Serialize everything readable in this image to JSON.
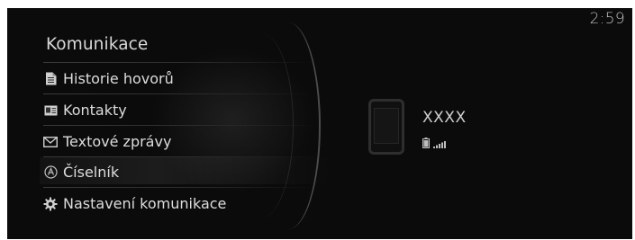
{
  "status_bar": {
    "time": "2:59"
  },
  "menu": {
    "title": "Komunikace",
    "items": [
      {
        "label": "Historie hovorů",
        "icon": "document-icon"
      },
      {
        "label": "Kontakty",
        "icon": "contact-card-icon"
      },
      {
        "label": "Textové zprávy",
        "icon": "envelope-icon"
      },
      {
        "label": "Číselník",
        "icon": "dialpad-icon",
        "selected": true
      },
      {
        "label": "Nastavení komunikace",
        "icon": "gear-icon"
      }
    ]
  },
  "device": {
    "name": "XXXX",
    "battery_icon": "battery-icon",
    "signal_icon": "signal-strength-icon"
  },
  "colors": {
    "background": "#0c0c0c",
    "text": "#dcdcdc",
    "accent_line": "#4c4c4c"
  }
}
